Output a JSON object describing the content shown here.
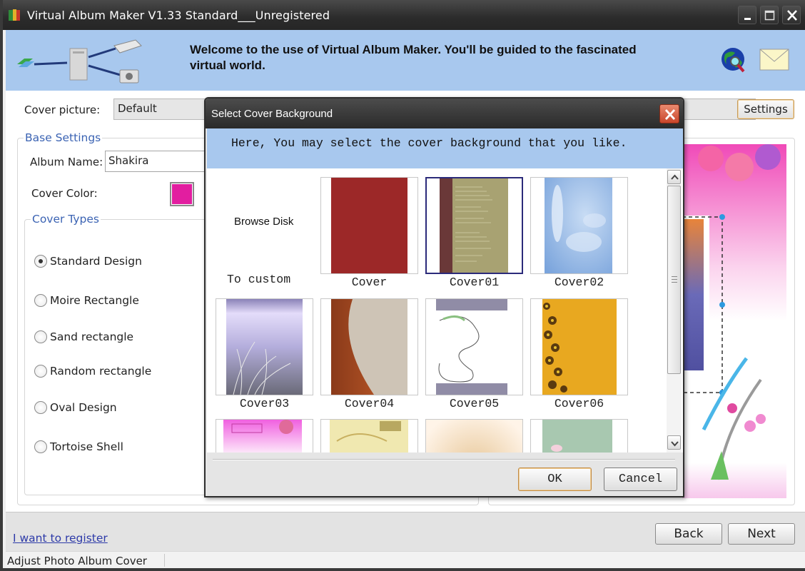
{
  "window": {
    "title": "Virtual Album Maker V1.33 Standard___Unregistered",
    "controls": [
      "minimize",
      "maximize",
      "close"
    ]
  },
  "banner": {
    "welcome_text": "Welcome to the use of Virtual Album Maker. You'll be guided to the fascinated virtual world.",
    "icons": [
      "logo-diagram-icon",
      "web-search-globe-icon",
      "email-envelope-icon"
    ]
  },
  "cover_picture": {
    "label": "Cover picture:",
    "value": "Default",
    "settings_label": "Settings"
  },
  "base_settings": {
    "legend": "Base Settings",
    "album_name_label": "Album Name:",
    "album_name_value": "Shakira",
    "cover_color_label": "Cover Color:",
    "cover_color": "#e21ea0"
  },
  "cover_types": {
    "legend": "Cover Types",
    "options": [
      {
        "label": "Standard Design",
        "selected": true
      },
      {
        "label": "Moire Rectangle",
        "selected": false
      },
      {
        "label": "Sand rectangle",
        "selected": false
      },
      {
        "label": "Random rectangle",
        "selected": false
      },
      {
        "label": "Oval Design",
        "selected": false
      },
      {
        "label": "Tortoise Shell",
        "selected": false
      }
    ]
  },
  "footer": {
    "register_link": "I want to register",
    "back_label": "Back",
    "next_label": "Next",
    "status_text": "Adjust Photo Album Cover"
  },
  "dialog": {
    "title": "Select Cover Background",
    "info_text": "Here, You may select the cover background that you like.",
    "browse_label": "Browse Disk",
    "custom_caption": "To custom",
    "thumbnails": [
      {
        "caption": "Cover",
        "selected": false
      },
      {
        "caption": "Cover01",
        "selected": true
      },
      {
        "caption": "Cover02",
        "selected": false
      },
      {
        "caption": "Cover03",
        "selected": false
      },
      {
        "caption": "Cover04",
        "selected": false
      },
      {
        "caption": "Cover05",
        "selected": false
      },
      {
        "caption": "Cover06",
        "selected": false
      },
      {
        "caption": "",
        "selected": false
      },
      {
        "caption": "",
        "selected": false
      },
      {
        "caption": "",
        "selected": false
      },
      {
        "caption": "",
        "selected": false
      }
    ],
    "ok_label": "OK",
    "cancel_label": "Cancel"
  }
}
